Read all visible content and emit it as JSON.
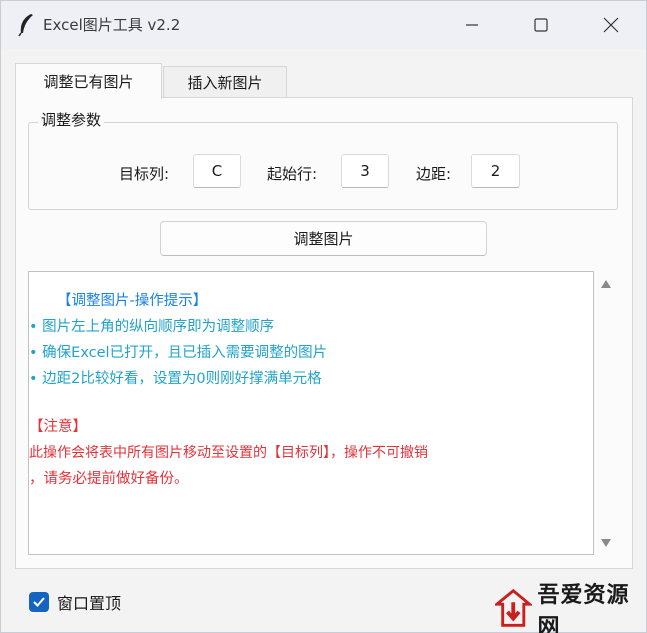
{
  "window": {
    "title": "Excel图片工具 v2.2",
    "icon": "feather-icon",
    "controls": [
      "minimize-icon",
      "maximize-icon",
      "close-icon"
    ]
  },
  "tabs": [
    {
      "label": "调整已有图片",
      "active": true
    },
    {
      "label": "插入新图片",
      "active": false
    }
  ],
  "params": {
    "title": "调整参数",
    "target_col_label": "目标列:",
    "target_col_value": "C",
    "start_row_label": "起始行:",
    "start_row_value": "3",
    "margin_label": "边距:",
    "margin_value": "2"
  },
  "action_button": "调整图片",
  "info": {
    "heading": "【调整图片-操作提示】",
    "tips": [
      "• 图片左上角的纵向顺序即为调整顺序",
      "• 确保Excel已打开，且已插入需要调整的图片",
      "• 边距2比较好看，设置为0则刚好撑满单元格"
    ],
    "warning_heading": "【注意】",
    "warning_lines": [
      "此操作会将表中所有图片移动至设置的【目标列】，操作不可撤销",
      "，请务必提前做好备份。"
    ]
  },
  "pin": {
    "label": "窗口置顶",
    "checked": true
  },
  "watermark": {
    "text": "吾爱资源网"
  },
  "colors": {
    "heading_blue": "#1a82e0",
    "tip_teal": "#21a3c7",
    "warning_red": "#e2333b",
    "checkbox_blue": "#1565c0"
  }
}
